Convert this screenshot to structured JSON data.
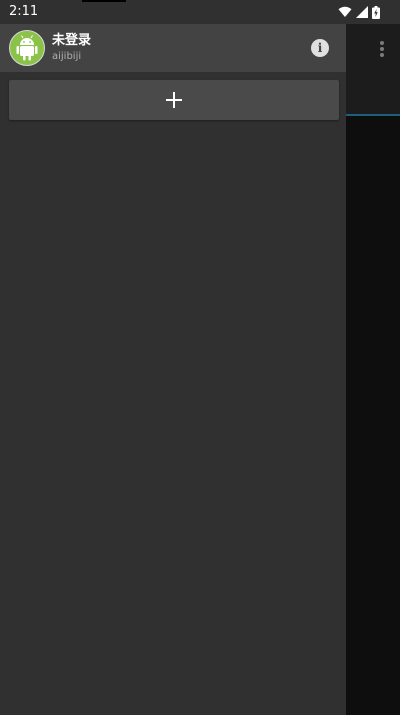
{
  "status_bar": {
    "time": "2:11",
    "icons": [
      "wifi-icon",
      "signal-icon",
      "battery-icon"
    ]
  },
  "drawer": {
    "header": {
      "avatar_icon": "android-icon",
      "user_name": "未登录",
      "user_subtitle": "aijibiji",
      "info_icon": "info-icon"
    },
    "add_button": {
      "icon": "plus-icon"
    }
  },
  "app": {
    "overflow_icon": "more-vert-icon"
  },
  "colors": {
    "avatar_bg": "#8bc34a",
    "drawer_bg": "#303030",
    "header_bg": "#434343",
    "add_button_bg": "#4a4a4a",
    "accent_line": "#1f5f7a"
  }
}
